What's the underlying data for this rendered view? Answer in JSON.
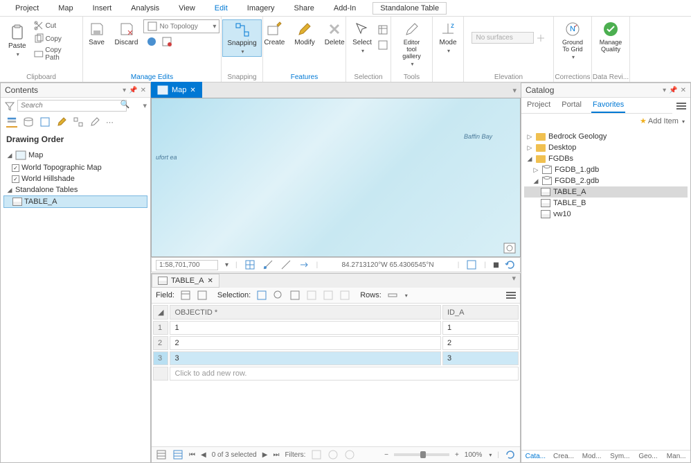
{
  "menu": {
    "project": "Project",
    "map": "Map",
    "insert": "Insert",
    "analysis": "Analysis",
    "view": "View",
    "edit": "Edit",
    "imagery": "Imagery",
    "share": "Share",
    "addin": "Add-In",
    "standalone": "Standalone Table"
  },
  "ribbon": {
    "paste": "Paste",
    "cut": "Cut",
    "copy": "Copy",
    "copypath": "Copy Path",
    "clipboard": "Clipboard",
    "save": "Save",
    "discard": "Discard",
    "topology": "No Topology",
    "manage_edits": "Manage Edits",
    "snapping": "Snapping",
    "snapping_grp": "Snapping",
    "create": "Create",
    "modify": "Modify",
    "delete": "Delete",
    "features": "Features",
    "select": "Select",
    "selection": "Selection",
    "editortool": "Editor tool gallery",
    "tools": "Tools",
    "mode": "Mode",
    "nosurfaces": "No surfaces",
    "elevation": "Elevation",
    "ground": "Ground To Grid",
    "corrections": "Corrections",
    "manage_quality": "Manage Quality",
    "datarevi": "Data Revi..."
  },
  "contents": {
    "title": "Contents",
    "search": "Search",
    "drawing_order": "Drawing Order",
    "map": "Map",
    "wtm": "World Topographic Map",
    "wh": "World Hillshade",
    "standalone": "Standalone Tables",
    "table_a": "TABLE_A"
  },
  "maptab": "Map",
  "map_labels": {
    "baffin": "Baffin Bay",
    "ufort": "ufort ea"
  },
  "status": {
    "scale": "1:58,701,700",
    "coords": "84.2713120°W 65.4306545°N"
  },
  "table": {
    "tab": "TABLE_A",
    "field": "Field:",
    "selection": "Selection:",
    "rows_lbl": "Rows:",
    "cols": [
      "OBJECTID *",
      "ID_A"
    ],
    "rows": [
      {
        "n": "1",
        "oid": "1",
        "ida": "1"
      },
      {
        "n": "2",
        "oid": "2",
        "ida": "2"
      },
      {
        "n": "3",
        "oid": "3",
        "ida": "3"
      }
    ],
    "addrow": "Click to add new row.",
    "footer": {
      "count": "0 of 3 selected",
      "filters": "Filters:",
      "zoom": "100%"
    }
  },
  "catalog": {
    "title": "Catalog",
    "tabs": {
      "project": "Project",
      "portal": "Portal",
      "favorites": "Favorites"
    },
    "additem": "Add Item",
    "bedrock": "Bedrock Geology",
    "desktop": "Desktop",
    "fgdbs": "FGDBs",
    "gdb1": "FGDB_1.gdb",
    "gdb2": "FGDB_2.gdb",
    "ta": "TABLE_A",
    "tb": "TABLE_B",
    "vw": "vw10",
    "btabs": {
      "cata": "Cata...",
      "crea": "Crea...",
      "mod": "Mod...",
      "sym": "Sym...",
      "geo": "Geo...",
      "man": "Man..."
    }
  }
}
